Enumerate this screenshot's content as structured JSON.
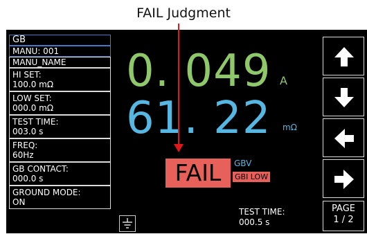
{
  "caption": "FAIL Judgment",
  "sidebar": {
    "title": "GB",
    "manu": "MANU: 001",
    "manu_name": "MANU_NAME",
    "hi_set": {
      "label": "HI SET:",
      "value": "100.0 mΩ"
    },
    "low_set": {
      "label": "LOW SET:",
      "value": "000.0 mΩ"
    },
    "test_time": {
      "label": "TEST TIME:",
      "value": "003.0 s"
    },
    "freq": {
      "label": "FREQ:",
      "value": "60Hz"
    },
    "gb_contact": {
      "label": "GB CONTACT:",
      "value": "000.0 s"
    },
    "ground_mode": {
      "label": "GROUND MODE:",
      "value": "ON"
    }
  },
  "readings": {
    "current": "0. 049",
    "current_unit": "A",
    "resistance": "61. 22",
    "resistance_unit": "mΩ"
  },
  "judgment": {
    "result": "FAIL",
    "mode": "GBV",
    "reason": "GBI LOW"
  },
  "elapsed": {
    "label": "TEST TIME:",
    "value": "000.5 s"
  },
  "nav": {
    "page_label": "PAGE",
    "page_value": "1 / 2"
  },
  "icons": [
    "arrow-up-icon",
    "arrow-down-icon",
    "arrow-left-icon",
    "arrow-right-icon",
    "ground-icon"
  ],
  "colors": {
    "current": "#8fc86a",
    "resistance": "#55b7e2",
    "fail": "#e8605a",
    "annotation": "#e01818"
  }
}
